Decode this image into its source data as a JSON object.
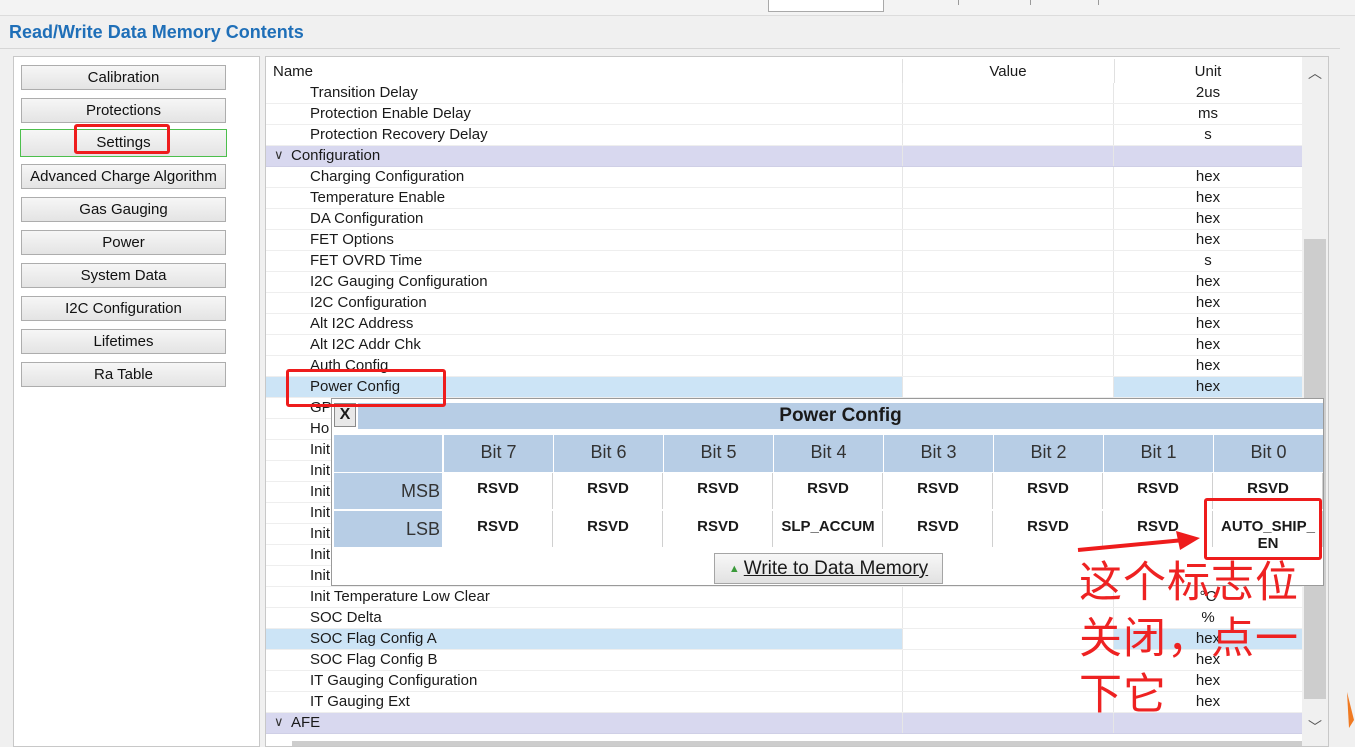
{
  "page_title": "Read/Write Data Memory Contents",
  "nav": [
    {
      "label": "Calibration"
    },
    {
      "label": "Protections"
    },
    {
      "label": "Settings",
      "active": true
    },
    {
      "label": "Advanced Charge Algorithm"
    },
    {
      "label": "Gas Gauging"
    },
    {
      "label": "Power"
    },
    {
      "label": "System Data"
    },
    {
      "label": "I2C Configuration"
    },
    {
      "label": "Lifetimes"
    },
    {
      "label": "Ra Table"
    }
  ],
  "table": {
    "headers": {
      "name": "Name",
      "value": "Value",
      "unit": "Unit"
    },
    "rows": [
      {
        "name": "Transition Delay",
        "value": "",
        "unit": "2us"
      },
      {
        "name": "Protection Enable Delay",
        "value": "",
        "unit": "ms"
      },
      {
        "name": "Protection Recovery Delay",
        "value": "",
        "unit": "s"
      },
      {
        "name": "Configuration",
        "group": true,
        "value": "",
        "unit": ""
      },
      {
        "name": "Charging Configuration",
        "value": "",
        "unit": "hex"
      },
      {
        "name": "Temperature Enable",
        "value": "",
        "unit": "hex"
      },
      {
        "name": "DA Configuration",
        "value": "",
        "unit": "hex"
      },
      {
        "name": "FET Options",
        "value": "",
        "unit": "hex"
      },
      {
        "name": "FET OVRD Time",
        "value": "",
        "unit": "s"
      },
      {
        "name": "I2C Gauging Configuration",
        "value": "",
        "unit": "hex"
      },
      {
        "name": "I2C Configuration",
        "value": "",
        "unit": "hex"
      },
      {
        "name": "Alt I2C Address",
        "value": "",
        "unit": "hex"
      },
      {
        "name": "Alt I2C Addr Chk",
        "value": "",
        "unit": "hex"
      },
      {
        "name": "Auth Config",
        "value": "",
        "unit": "hex"
      },
      {
        "name": "Power Config",
        "value": "",
        "unit": "hex",
        "selected": true
      },
      {
        "name": "GP",
        "value": "",
        "unit": ""
      },
      {
        "name": "Ho",
        "value": "",
        "unit": ""
      },
      {
        "name": "Init",
        "value": "",
        "unit": ""
      },
      {
        "name": "Init",
        "value": "",
        "unit": ""
      },
      {
        "name": "Init",
        "value": "",
        "unit": ""
      },
      {
        "name": "Init",
        "value": "",
        "unit": ""
      },
      {
        "name": "Init",
        "value": "",
        "unit": ""
      },
      {
        "name": "Init",
        "value": "",
        "unit": ""
      },
      {
        "name": "Init",
        "value": "",
        "unit": ""
      },
      {
        "name": "Init Temperature Low Clear",
        "value": "",
        "unit": "°C"
      },
      {
        "name": "SOC Delta",
        "value": "",
        "unit": "%"
      },
      {
        "name": "SOC Flag Config A",
        "value": "",
        "unit": "hex",
        "tinted": true
      },
      {
        "name": "SOC Flag Config B",
        "value": "",
        "unit": "hex"
      },
      {
        "name": "IT Gauging Configuration",
        "value": "",
        "unit": "hex"
      },
      {
        "name": "IT Gauging Ext",
        "value": "",
        "unit": "hex"
      },
      {
        "name": "AFE",
        "group": true,
        "value": "",
        "unit": ""
      }
    ]
  },
  "popup": {
    "close_label": "X",
    "title": "Power Config",
    "bit_headers": [
      "Bit 7",
      "Bit 6",
      "Bit 5",
      "Bit 4",
      "Bit 3",
      "Bit 2",
      "Bit 1",
      "Bit 0"
    ],
    "msb_label": "MSB",
    "lsb_label": "LSB",
    "msb_bits": [
      "RSVD",
      "RSVD",
      "RSVD",
      "RSVD",
      "RSVD",
      "RSVD",
      "RSVD",
      "RSVD"
    ],
    "lsb_bits": [
      "RSVD",
      "RSVD",
      "RSVD",
      "SLP_ACCUM",
      "RSVD",
      "RSVD",
      "RSVD",
      "AUTO_SHIP_\nEN"
    ],
    "write_button": "Write to Data Memory"
  },
  "annotation": {
    "text": "这个标志位关闭，点一下它",
    "color": "#ee1c1c"
  },
  "icons": {
    "expand": "chevron-down-icon",
    "scroll_up": "chevron-up-icon",
    "scroll_down": "chevron-down-icon",
    "write": "arrow-up-icon"
  }
}
